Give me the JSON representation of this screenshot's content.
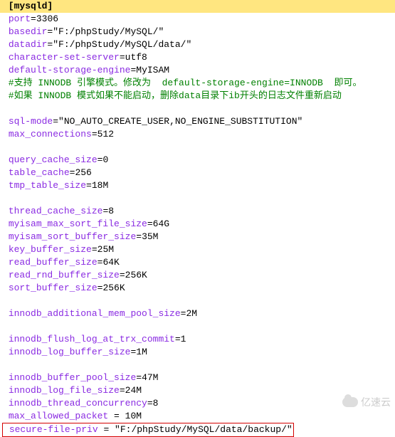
{
  "section": "[mysqld]",
  "lines": [
    {
      "type": "kv",
      "key": "port",
      "val": "3306"
    },
    {
      "type": "kv",
      "key": "basedir",
      "val": "\"F:/phpStudy/MySQL/\""
    },
    {
      "type": "kv",
      "key": "datadir",
      "val": "\"F:/phpStudy/MySQL/data/\""
    },
    {
      "type": "kv",
      "key": "character-set-server",
      "val": "utf8"
    },
    {
      "type": "kv",
      "key": "default-storage-engine",
      "val": "MyISAM"
    },
    {
      "type": "comment",
      "text": "#支持 INNODB 引擎模式。修改为  default-storage-engine=INNODB  即可。"
    },
    {
      "type": "comment",
      "text": "#如果 INNODB 模式如果不能启动，删除data目录下ib开头的日志文件重新启动"
    },
    {
      "type": "blank"
    },
    {
      "type": "kv",
      "key": "sql-mode",
      "val": "\"NO_AUTO_CREATE_USER,NO_ENGINE_SUBSTITUTION\""
    },
    {
      "type": "kv",
      "key": "max_connections",
      "val": "512"
    },
    {
      "type": "blank"
    },
    {
      "type": "kv",
      "key": "query_cache_size",
      "val": "0"
    },
    {
      "type": "kv",
      "key": "table_cache",
      "val": "256"
    },
    {
      "type": "kv",
      "key": "tmp_table_size",
      "val": "18M"
    },
    {
      "type": "blank"
    },
    {
      "type": "kv",
      "key": "thread_cache_size",
      "val": "8"
    },
    {
      "type": "kv",
      "key": "myisam_max_sort_file_size",
      "val": "64G"
    },
    {
      "type": "kv",
      "key": "myisam_sort_buffer_size",
      "val": "35M"
    },
    {
      "type": "kv",
      "key": "key_buffer_size",
      "val": "25M"
    },
    {
      "type": "kv",
      "key": "read_buffer_size",
      "val": "64K"
    },
    {
      "type": "kv",
      "key": "read_rnd_buffer_size",
      "val": "256K"
    },
    {
      "type": "kv",
      "key": "sort_buffer_size",
      "val": "256K"
    },
    {
      "type": "blank"
    },
    {
      "type": "kv",
      "key": "innodb_additional_mem_pool_size",
      "val": "2M"
    },
    {
      "type": "blank"
    },
    {
      "type": "kv",
      "key": "innodb_flush_log_at_trx_commit",
      "val": "1"
    },
    {
      "type": "kv",
      "key": "innodb_log_buffer_size",
      "val": "1M"
    },
    {
      "type": "blank"
    },
    {
      "type": "kv",
      "key": "innodb_buffer_pool_size",
      "val": "47M"
    },
    {
      "type": "kv",
      "key": "innodb_log_file_size",
      "val": "24M"
    },
    {
      "type": "kv",
      "key": "innodb_thread_concurrency",
      "val": "8"
    },
    {
      "type": "kv_sp",
      "key": "max_allowed_packet",
      "val": "10M"
    }
  ],
  "highlighted": {
    "key": "secure-file-priv",
    "val": "\"F:/phpStudy/MySQL/data/backup/\""
  },
  "watermark": "亿速云"
}
